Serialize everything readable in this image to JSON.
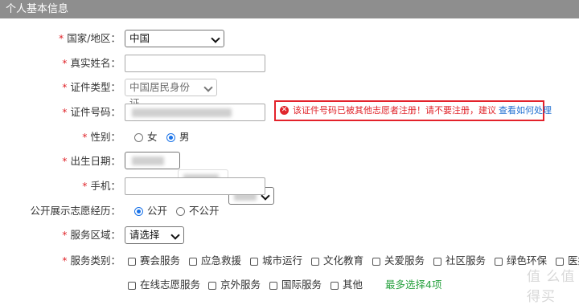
{
  "section_title": "个人基本信息",
  "required_mark": "*",
  "fields": {
    "country": {
      "label": "国家/地区：",
      "value": "中国"
    },
    "real_name": {
      "label": "真实姓名：",
      "value": ""
    },
    "id_type": {
      "label": "证件类型：",
      "value": "中国居民身份证"
    },
    "id_number": {
      "label": "证件号码：",
      "value": ""
    },
    "gender": {
      "label": "性别：",
      "options": [
        "女",
        "男"
      ],
      "selected": "男"
    },
    "birth_date": {
      "label": "出生日期："
    },
    "phone": {
      "label": "手机：",
      "value": ""
    },
    "public_history": {
      "label": "公开展示志愿经历：",
      "options": [
        "公开",
        "不公开"
      ],
      "selected": "公开"
    },
    "service_area": {
      "label": "服务区域：",
      "value": "请选择"
    },
    "service_type": {
      "label": "服务类别：",
      "row1": [
        "赛会服务",
        "应急救援",
        "城市运行",
        "文化教育",
        "关爱服务",
        "社区服务",
        "绿色环保",
        "医疗"
      ],
      "row2": [
        "在线志愿服务",
        "京外服务",
        "国际服务",
        "其他"
      ],
      "hint": "最多选择4项"
    }
  },
  "error": {
    "icon": "error-circle-icon",
    "text": "该证件号码已被其他志愿者注册！请不要注册，建议",
    "link": "查看如何处理"
  },
  "watermark": "值 么值得买",
  "colors": {
    "header_bg": "#8e8e8e",
    "error": "#e3222b",
    "link": "#1f6fd1",
    "hint": "#2aa241",
    "radio": "#1a73e8"
  }
}
